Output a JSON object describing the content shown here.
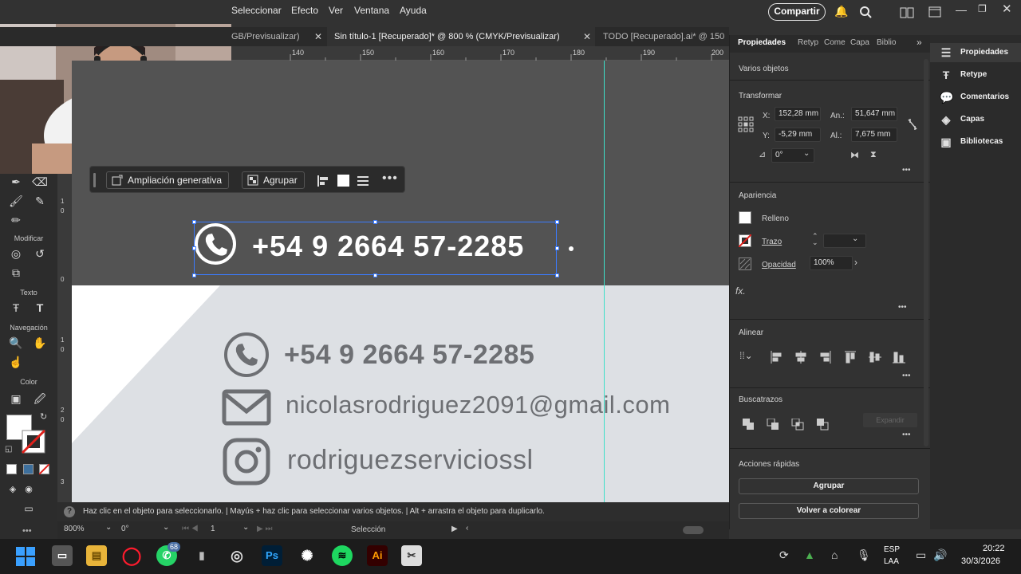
{
  "menu": {
    "items": [
      "Seleccionar",
      "Efecto",
      "Ver",
      "Ventana",
      "Ayuda"
    ],
    "share_label": "Compartir"
  },
  "tabs": [
    {
      "label": "GB/Previsualizar)",
      "active": false
    },
    {
      "label": "Sin título-1 [Recuperado]* @ 800 % (CMYK/Previsualizar)",
      "active": true
    },
    {
      "label": "TODO [Recuperado].ai* @ 150",
      "active": false
    }
  ],
  "ruler": {
    "h_ticks": [
      "140",
      "150",
      "160",
      "170",
      "180",
      "190",
      "200"
    ],
    "v_ticks": [
      "1",
      "0",
      "0",
      "1",
      "0",
      "2",
      "0",
      "3"
    ]
  },
  "toolbar": {
    "sections": {
      "modify": "Modificar",
      "text": "Texto",
      "navigation": "Navegación",
      "color": "Color"
    }
  },
  "context_bar": {
    "generative_label": "Ampliación generativa",
    "group_label": "Agrupar"
  },
  "selection": {
    "phone_text": "+54 9 2664 57-2285"
  },
  "card": {
    "phone": "+54 9 2664 57-2285",
    "email": "nicolasrodriguez2091@gmail.com",
    "instagram": "rodriguezserviciossl"
  },
  "status": {
    "hint": "Haz clic en el objeto para seleccionarlo.  |  Mayús + haz clic para seleccionar varios objetos.  |  Alt + arrastra el objeto para duplicarlo.",
    "zoom": "800%",
    "rotation": "0°",
    "artboard_num": "1",
    "tool_name": "Selección"
  },
  "panel": {
    "tabs": [
      "Propiedades",
      "Retyp",
      "Come",
      "Capa",
      "Biblio"
    ],
    "object_type": "Varios objetos",
    "transform": {
      "header": "Transformar",
      "x_label": "X:",
      "x": "152,28 mm",
      "y_label": "Y:",
      "y": "-5,29 mm",
      "w_label": "An.:",
      "w": "51,647 mm",
      "h_label": "Al.:",
      "h": "7,675 mm",
      "angle": "0°"
    },
    "appearance": {
      "header": "Apariencia",
      "fill": "Relleno",
      "stroke": "Trazo",
      "opacity_label": "Opacidad",
      "opacity": "100%"
    },
    "fx_label": "fx.",
    "align_header": "Alinear",
    "pathfinder": {
      "header": "Buscatrazos",
      "expand": "Expandir"
    },
    "quick_actions": {
      "header": "Acciones rápidas",
      "group": "Agrupar",
      "recolor": "Volver a colorear"
    }
  },
  "sidebar": {
    "items": [
      "Propiedades",
      "Retype",
      "Comentarios",
      "Capas",
      "Bibliotecas"
    ]
  },
  "taskbar": {
    "whatsapp_badge": "68",
    "lang": "ESP",
    "lang2": "LAA",
    "time": "20:22",
    "date": "30/3/2026"
  },
  "colors": {
    "accent": "#3b7bff",
    "guide": "#3ee0c9",
    "card_bg": "#dde0e4",
    "card_text": "#6d6f73"
  }
}
